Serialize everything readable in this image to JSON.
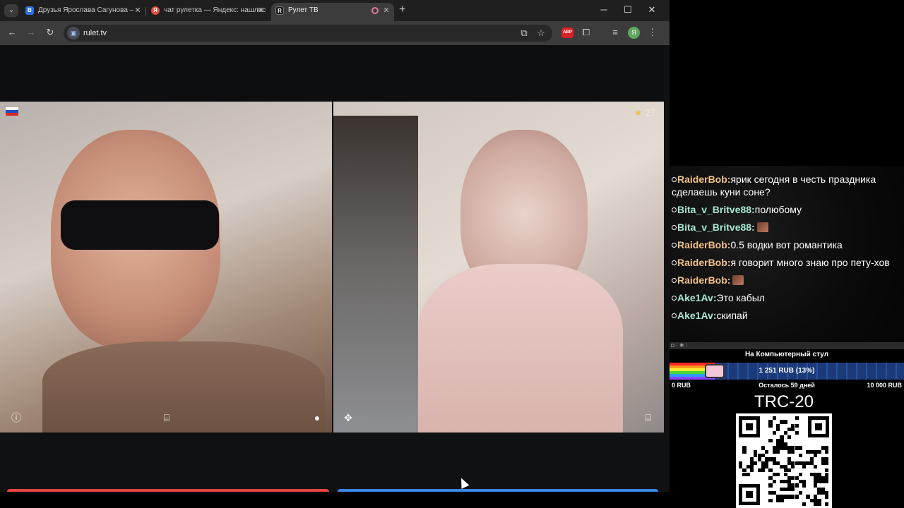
{
  "browser": {
    "tabs": [
      {
        "title": "Друзья Ярослава Сагунова – ",
        "favicon": "В",
        "favicon_color": "#2f6fe3",
        "active": false
      },
      {
        "title": "чат рулетка — Яндекс: нашлос",
        "favicon": "Я",
        "favicon_color": "#e64b3b",
        "active": false
      },
      {
        "title": "Рулет ТВ",
        "favicon": "R",
        "favicon_color": "#1b1b1b",
        "active": true
      }
    ],
    "new_tab_icon": "plus-icon",
    "url": "rulet.tv",
    "abp_label": "ABP",
    "profile_letter": "Я"
  },
  "video": {
    "left_flag": "russia-flag",
    "rating_value": "27",
    "flag_colors": [
      "#ffffff",
      "#1f4fbf",
      "#d52b1e"
    ]
  },
  "colors": {
    "red_action": "#e5463d",
    "blue_action": "#3b86e6",
    "chat_user": "#f2c08a",
    "chat_user_alt": "#a7e7d3"
  },
  "overlay": {
    "chat": [
      {
        "user": "RaiderBob",
        "text": "ярик сегодня в честь праздника сделаешь куни соне?",
        "color": "#f2c08a",
        "emote": false
      },
      {
        "user": "Bita_v_Britve88",
        "text": "полюбому",
        "color": "#a7e7d3",
        "emote": false
      },
      {
        "user": "Bita_v_Britve88",
        "text": "",
        "color": "#a7e7d3",
        "emote": true
      },
      {
        "user": "RaiderBob",
        "text": "0.5 водки вот романтика",
        "color": "#f2c08a",
        "emote": false
      },
      {
        "user": "RaiderBob",
        "text": "я говорит много знаю про пету-хов",
        "color": "#f2c08a",
        "emote": false
      },
      {
        "user": "RaiderBob",
        "text": "",
        "color": "#f2c08a",
        "emote": true
      },
      {
        "user": "Ake1Av",
        "text": "Это кабыл",
        "color": "#a7e7d3",
        "emote": false
      },
      {
        "user": "Ake1Av",
        "text": "скипай",
        "color": "#a7e7d3",
        "emote": false
      }
    ],
    "goal": {
      "title": "На Компьютерный стул",
      "amount": "1 251 RUB (13%)",
      "progress_fraction": 0.13,
      "min": "0 RUB",
      "left": "Осталось 59 дней",
      "max": "10 000 RUB"
    },
    "wallet_label": "TRC-20"
  }
}
